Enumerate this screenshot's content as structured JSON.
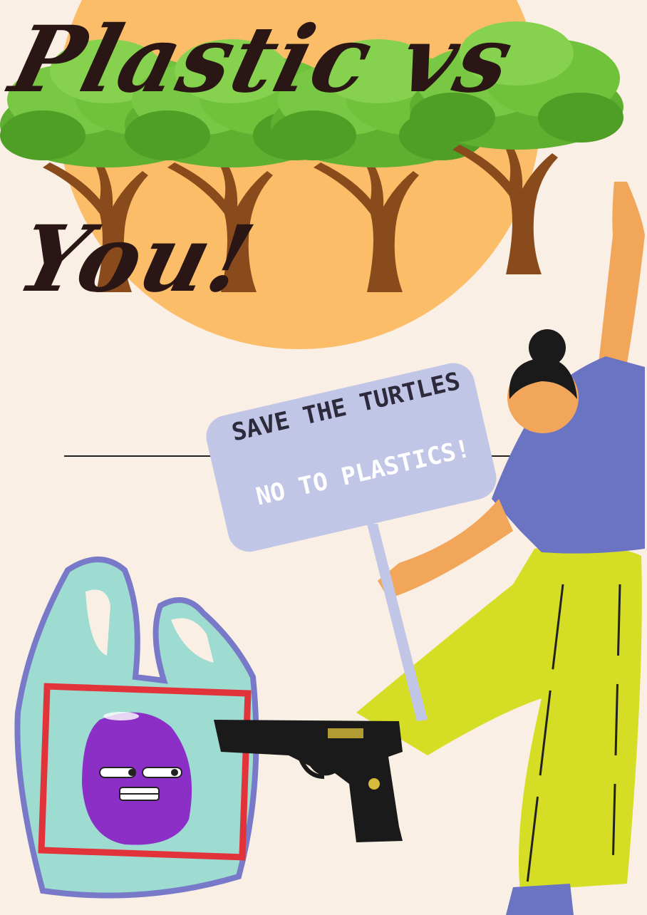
{
  "poster": {
    "title_line1": "Plastic vs",
    "title_line2": "You!",
    "sign_line1": "SAVE THE TURTLES",
    "sign_line2": "NO TO PLASTICS!"
  },
  "colors": {
    "background": "#f9efe4",
    "sun": "#fbbd68",
    "foliage": "#6fc23a",
    "trunk": "#8a4b1c",
    "sign": "#c2c6e6",
    "shirt": "#6b73c3",
    "pants": "#d6dd25",
    "skin": "#f1a65a",
    "bag": "#9edbd0",
    "bag_outline": "#7879c8",
    "bag_frame": "#e2323a",
    "blob": "#8b2fc7",
    "gun": "#1a1a1a"
  },
  "icons": [
    "tree-icon",
    "sun-icon",
    "protester-figure",
    "protest-sign",
    "plastic-bag-icon",
    "angry-blob-icon",
    "pistol-icon"
  ]
}
